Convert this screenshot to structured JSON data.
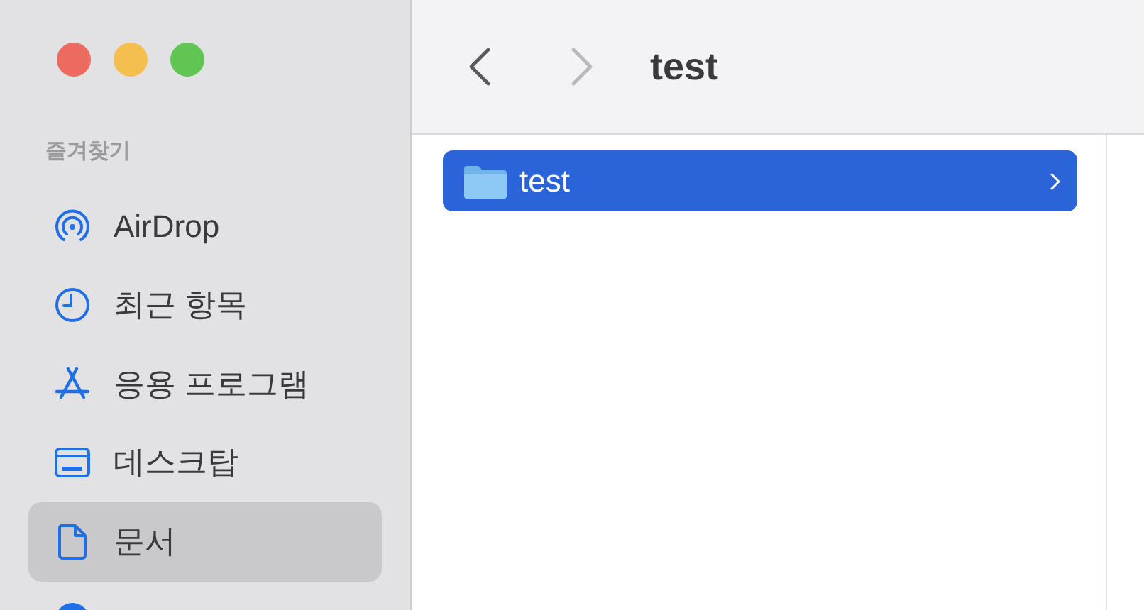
{
  "window": {
    "title": "test"
  },
  "navigation": {
    "back": {
      "disabled": false
    },
    "forward": {
      "disabled": true
    }
  },
  "sidebar": {
    "section_title": "즐겨찾기",
    "items": [
      {
        "kind": "airdrop",
        "label": "AirDrop",
        "selected": false
      },
      {
        "kind": "clock",
        "label": "최근 항목",
        "selected": false
      },
      {
        "kind": "apps",
        "label": "응용 프로그램",
        "selected": false
      },
      {
        "kind": "desktop",
        "label": "데스크탑",
        "selected": false
      },
      {
        "kind": "document",
        "label": "문서",
        "selected": true
      },
      {
        "kind": "circle",
        "selected": false
      }
    ]
  },
  "columns": [
    {
      "rows": [
        {
          "name": "test",
          "selected": true,
          "expandable": true
        }
      ]
    }
  ]
}
